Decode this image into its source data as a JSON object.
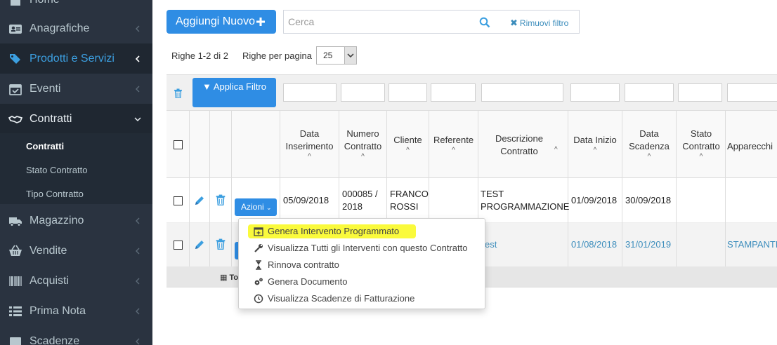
{
  "sidebar": {
    "items": [
      {
        "label": "Home"
      },
      {
        "label": "Anagrafiche"
      },
      {
        "label": "Prodotti e Servizi"
      },
      {
        "label": "Eventi"
      },
      {
        "label": "Contratti"
      },
      {
        "label": "Magazzino"
      },
      {
        "label": "Vendite"
      },
      {
        "label": "Acquisti"
      },
      {
        "label": "Prima Nota"
      },
      {
        "label": "Scadenze"
      }
    ],
    "subitems": [
      {
        "label": "Contratti"
      },
      {
        "label": "Stato Contratto"
      },
      {
        "label": "Tipo Contratto"
      }
    ]
  },
  "toolbar": {
    "add_label": "Aggiungi Nuovo",
    "search_placeholder": "Cerca",
    "clear_filter_label": "Rimuovi filtro",
    "rows_info": "Righe 1-2 di 2",
    "rows_per_page_label": "Righe per pagina",
    "rows_per_page_value": "25"
  },
  "table": {
    "apply_filter_label": "Applica Filtro",
    "headers": {
      "data_inserimento": "Data Inserimento",
      "numero_contratto": "Numero Contratto",
      "cliente": "Cliente",
      "referente": "Referente",
      "descrizione": "Descrizione Contratto",
      "data_inizio": "Data Inizio",
      "data_scadenza": "Data Scadenza",
      "stato": "Stato Contratto",
      "apparecchi": "Apparecchi"
    },
    "sort_icon": "^",
    "actions_label": "Azioni",
    "rows": [
      {
        "data_inserimento": "05/09/2018",
        "numero_contratto": "000085 / 2018",
        "cliente": "FRANCO ROSSI",
        "referente": "",
        "descrizione": "TEST PROGRAMMAZIONE",
        "data_inizio": "01/09/2018",
        "data_scadenza": "30/09/2018",
        "stato": "",
        "apparecchi": ""
      },
      {
        "descrizione": "est",
        "data_inizio": "01/08/2018",
        "data_scadenza": "31/01/2019",
        "apparecchi": "STAMPANTE"
      }
    ],
    "footer_total": "To"
  },
  "actions_menu": {
    "items": [
      {
        "label": "Genera Intervento Programmato",
        "icon": "calendar-plus-icon"
      },
      {
        "label": "Visualizza Tutti gli Interventi con questo Contratto",
        "icon": "wrench-icon"
      },
      {
        "label": "Rinnova contratto",
        "icon": "hourglass-icon"
      },
      {
        "label": "Genera Documento",
        "icon": "cogs-icon"
      },
      {
        "label": "Visualizza Scadenze di Fatturazione",
        "icon": "clock-icon"
      }
    ]
  },
  "colors": {
    "sidebar_bg": "#2a3340",
    "accent_blue": "#2f8de4",
    "highlight_yellow": "#fafa3c"
  }
}
